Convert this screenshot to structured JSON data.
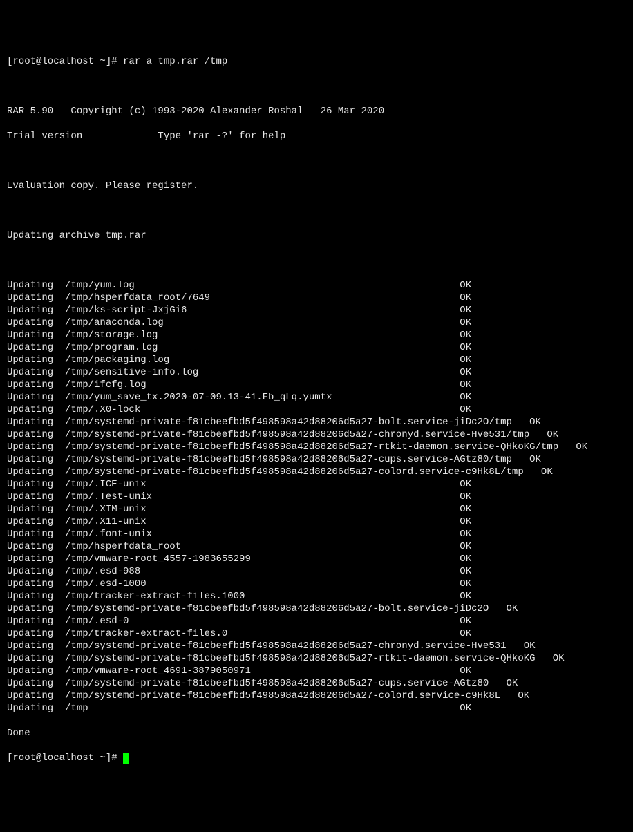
{
  "prompt1": "[root@localhost ~]# rar a tmp.rar /tmp",
  "blank": "",
  "header1": "RAR 5.90   Copyright (c) 1993-2020 Alexander Roshal   26 Mar 2020",
  "header2": "Trial version             Type 'rar -?' for help",
  "eval": "Evaluation copy. Please register.",
  "updating_archive": "Updating archive tmp.rar",
  "lines": [
    "Updating  /tmp/yum.log                                                        OK ",
    "Updating  /tmp/hsperfdata_root/7649                                           OK ",
    "Updating  /tmp/ks-script-JxjGi6                                               OK ",
    "Updating  /tmp/anaconda.log                                                   OK ",
    "Updating  /tmp/storage.log                                                    OK ",
    "Updating  /tmp/program.log                                                    OK ",
    "Updating  /tmp/packaging.log                                                  OK ",
    "Updating  /tmp/sensitive-info.log                                             OK ",
    "Updating  /tmp/ifcfg.log                                                      OK ",
    "Updating  /tmp/yum_save_tx.2020-07-09.13-41.Fb_qLq.yumtx                      OK ",
    "Updating  /tmp/.X0-lock                                                       OK ",
    "Updating  /tmp/systemd-private-f81cbeefbd5f498598a42d88206d5a27-bolt.service-jiDc2O/tmp   OK ",
    "Updating  /tmp/systemd-private-f81cbeefbd5f498598a42d88206d5a27-chronyd.service-Hve531/tmp   OK ",
    "Updating  /tmp/systemd-private-f81cbeefbd5f498598a42d88206d5a27-rtkit-daemon.service-QHkoKG/tmp   OK ",
    "Updating  /tmp/systemd-private-f81cbeefbd5f498598a42d88206d5a27-cups.service-AGtz80/tmp   OK ",
    "Updating  /tmp/systemd-private-f81cbeefbd5f498598a42d88206d5a27-colord.service-c9Hk8L/tmp   OK ",
    "Updating  /tmp/.ICE-unix                                                      OK ",
    "Updating  /tmp/.Test-unix                                                     OK ",
    "Updating  /tmp/.XIM-unix                                                      OK ",
    "Updating  /tmp/.X11-unix                                                      OK ",
    "Updating  /tmp/.font-unix                                                     OK ",
    "Updating  /tmp/hsperfdata_root                                                OK ",
    "Updating  /tmp/vmware-root_4557-1983655299                                    OK ",
    "Updating  /tmp/.esd-988                                                       OK ",
    "Updating  /tmp/.esd-1000                                                      OK ",
    "Updating  /tmp/tracker-extract-files.1000                                     OK ",
    "Updating  /tmp/systemd-private-f81cbeefbd5f498598a42d88206d5a27-bolt.service-jiDc2O   OK ",
    "Updating  /tmp/.esd-0                                                         OK ",
    "Updating  /tmp/tracker-extract-files.0                                        OK ",
    "Updating  /tmp/systemd-private-f81cbeefbd5f498598a42d88206d5a27-chronyd.service-Hve531   OK ",
    "Updating  /tmp/systemd-private-f81cbeefbd5f498598a42d88206d5a27-rtkit-daemon.service-QHkoKG   OK ",
    "Updating  /tmp/vmware-root_4691-3879050971                                    OK ",
    "Updating  /tmp/systemd-private-f81cbeefbd5f498598a42d88206d5a27-cups.service-AGtz80   OK ",
    "Updating  /tmp/systemd-private-f81cbeefbd5f498598a42d88206d5a27-colord.service-c9Hk8L   OK ",
    "Updating  /tmp                                                                OK "
  ],
  "done": "Done",
  "prompt2": "[root@localhost ~]# "
}
